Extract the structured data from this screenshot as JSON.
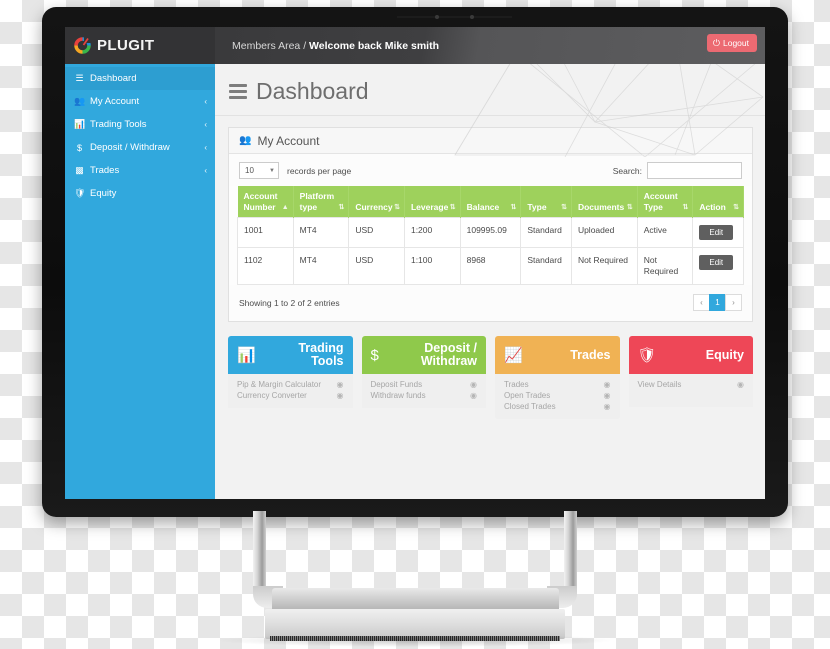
{
  "brand": {
    "name": "PLUGIT",
    "logo_icon": "plugit-ring-logo",
    "logo_colors": [
      "#e8413d",
      "#f5a623",
      "#39b54a",
      "#1f8fd6"
    ]
  },
  "header": {
    "breadcrumb_prefix": "Members Area /",
    "breadcrumb_current": "Welcome back Mike smith",
    "logout_label": "Logout",
    "logout_icon": "power-icon",
    "logout_color": "#ec6a72"
  },
  "sidebar": {
    "bg_color": "#31a8dd",
    "items": [
      {
        "label": "Dashboard",
        "icon": "bars-icon",
        "active": true,
        "caret": ""
      },
      {
        "label": "My Account",
        "icon": "users-icon",
        "active": false,
        "caret": "‹"
      },
      {
        "label": "Trading Tools",
        "icon": "bar-chart-icon",
        "active": false,
        "caret": "‹"
      },
      {
        "label": "Deposit / Withdraw",
        "icon": "dollar-icon",
        "active": false,
        "caret": "‹"
      },
      {
        "label": "Trades",
        "icon": "signal-icon",
        "active": false,
        "caret": "‹"
      },
      {
        "label": "Equity",
        "icon": "shield-icon",
        "active": false,
        "caret": ""
      }
    ]
  },
  "page": {
    "title": "Dashboard",
    "menu_icon": "hamburger-icon"
  },
  "panel": {
    "icon": "users-icon",
    "title": "My Account",
    "records_per_page_value": "10",
    "records_per_page_label": "records per page",
    "search_label": "Search:",
    "search_value": "",
    "search_placeholder": ""
  },
  "table": {
    "header_color": "#9ed15c",
    "columns": [
      {
        "label": "Account Number",
        "sort": "asc"
      },
      {
        "label": "Platform type",
        "sort": "none"
      },
      {
        "label": "Currency",
        "sort": "none"
      },
      {
        "label": "Leverage",
        "sort": "none"
      },
      {
        "label": "Balance",
        "sort": "none"
      },
      {
        "label": "Type",
        "sort": "none"
      },
      {
        "label": "Documents",
        "sort": "none"
      },
      {
        "label": "Account Type",
        "sort": "none"
      },
      {
        "label": "Action",
        "sort": "none"
      }
    ],
    "rows": [
      {
        "account_number": "1001",
        "platform_type": "MT4",
        "currency": "USD",
        "leverage": "1:200",
        "balance": "109995.09",
        "type": "Standard",
        "documents": "Uploaded",
        "account_type": "Active",
        "action": "Edit"
      },
      {
        "account_number": "1102",
        "platform_type": "MT4",
        "currency": "USD",
        "leverage": "1:100",
        "balance": "8968",
        "type": "Standard",
        "documents": "Not Required",
        "account_type": "Not Required",
        "action": "Edit"
      }
    ],
    "entries_info": "Showing 1 to 2 of 2 entries",
    "pager": {
      "prev": "‹",
      "pages": [
        "1"
      ],
      "next": "›",
      "current": "1"
    }
  },
  "cards": [
    {
      "title_line1": "Trading",
      "title_line2": "Tools",
      "icon": "bar-chart-icon",
      "color": "#31a8dd",
      "links": [
        "Pip & Margin Calculator",
        "Currency Converter"
      ]
    },
    {
      "title_line1": "Deposit /",
      "title_line2": "Withdraw",
      "icon": "dollar-icon",
      "color": "#8fc94b",
      "links": [
        "Deposit Funds",
        "Withdraw funds"
      ]
    },
    {
      "title_line1": "Trades",
      "title_line2": "",
      "icon": "signal-icon",
      "color": "#f0b254",
      "links": [
        "Trades",
        "Open Trades",
        "Closed Trades"
      ]
    },
    {
      "title_line1": "Equity",
      "title_line2": "",
      "icon": "shield-icon",
      "color": "#ee4757",
      "links": [
        "View Details"
      ]
    }
  ]
}
